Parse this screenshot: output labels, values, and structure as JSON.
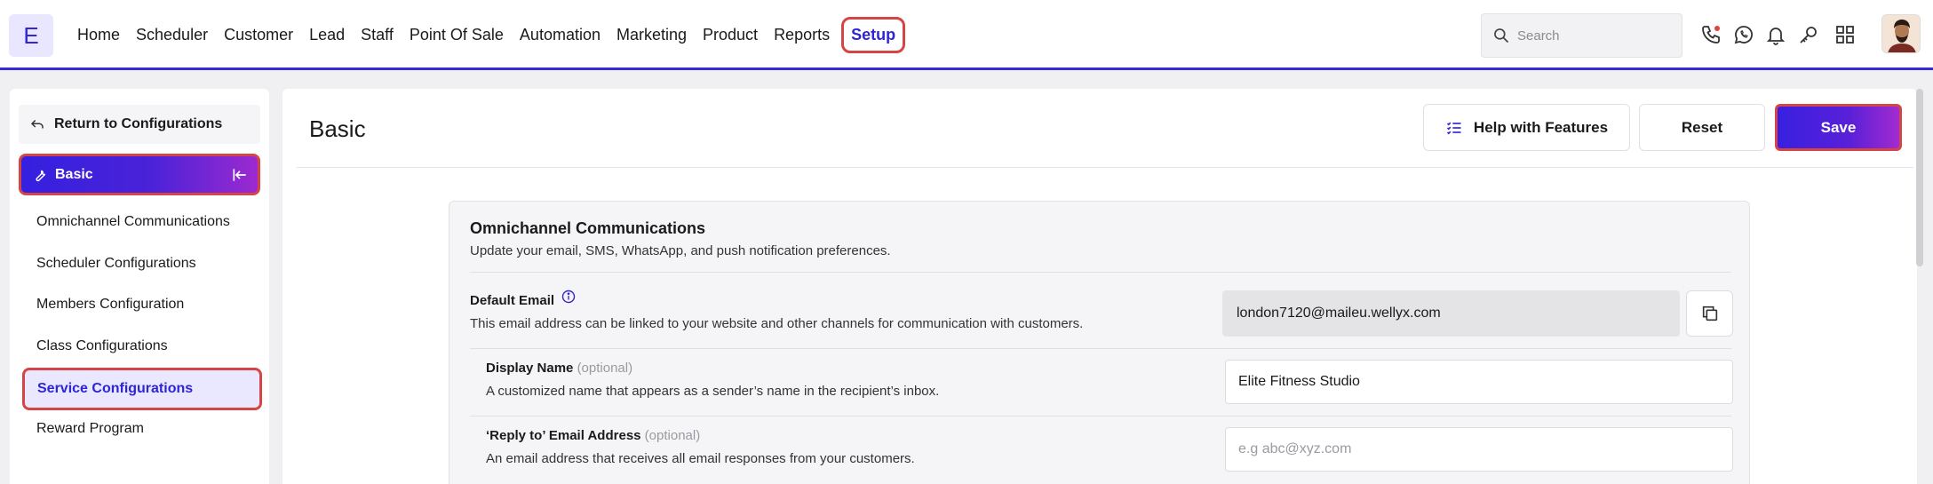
{
  "app": {
    "logo_letter": "E"
  },
  "nav": {
    "items": [
      "Home",
      "Scheduler",
      "Customer",
      "Lead",
      "Staff",
      "Point Of Sale",
      "Automation",
      "Marketing",
      "Product",
      "Reports"
    ],
    "active": "Setup"
  },
  "search": {
    "placeholder": "Search"
  },
  "top_icons": [
    "phone-icon",
    "whatsapp-icon",
    "bell-icon",
    "key-icon",
    "grid-icon"
  ],
  "sidebar": {
    "return_label": "Return to Configurations",
    "section_label": "Basic",
    "items": [
      "Omnichannel Communications",
      "Scheduler Configurations",
      "Members Configuration",
      "Class Configurations",
      "Service Configurations",
      "Reward Program"
    ],
    "active_item": "Service Configurations"
  },
  "main": {
    "title": "Basic",
    "help_label": "Help with Features",
    "reset_label": "Reset",
    "save_label": "Save"
  },
  "card": {
    "title": "Omnichannel Communications",
    "description": "Update your email, SMS, WhatsApp, and push notification preferences.",
    "default_email": {
      "label": "Default Email",
      "description": "This email address can be linked to your website and other channels for communication with customers.",
      "value": "london7120@maileu.wellyx.com"
    },
    "display_name": {
      "label": "Display Name",
      "optional": "(optional)",
      "description": "A customized name that appears as a sender’s name in the recipient’s inbox.",
      "value": "Elite Fitness Studio"
    },
    "reply_to": {
      "label": "‘Reply to’ Email Address",
      "optional": "(optional)",
      "description": "An email address that receives all email responses from your customers.",
      "placeholder": "e.g abc@xyz.com"
    }
  },
  "colors": {
    "brand": "#3326d6",
    "highlight_border": "#d64545",
    "active_bg": "#e9e8fe"
  }
}
